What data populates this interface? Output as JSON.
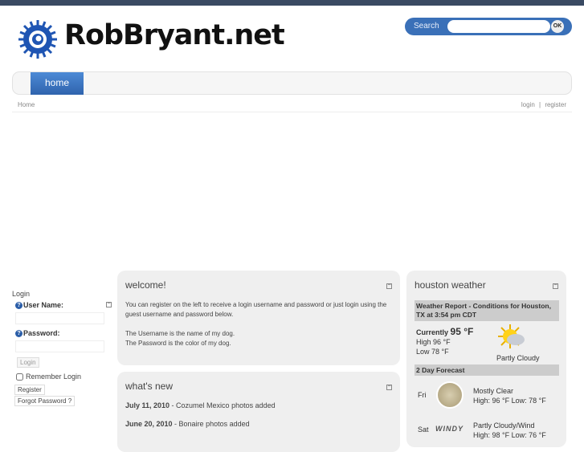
{
  "site": {
    "title": "RobBryant.net"
  },
  "search": {
    "label": "Search",
    "button": "OK",
    "value": ""
  },
  "nav": {
    "items": [
      "home"
    ]
  },
  "breadcrumb": "Home",
  "user_links": {
    "login": "login",
    "separator": "|",
    "register": "register"
  },
  "login": {
    "title": "Login",
    "username_label": "User Name:",
    "password_label": "Password:",
    "login_button": "Login",
    "remember": "Remember Login",
    "register_button": "Register",
    "forgot_button": "Forgot Password ?"
  },
  "welcome": {
    "title": "welcome!",
    "lines": [
      "You can register on the left to receive a login username and password or just login using the guest username and password below.",
      "The Username is the name of my dog.",
      "The Password is the color of my dog."
    ]
  },
  "whats_new": {
    "title": "what's new",
    "items": [
      {
        "date": "July 11, 2010",
        "text": " - Cozumel Mexico photos added"
      },
      {
        "date": "June 20, 2010",
        "text": " - Bonaire photos added"
      }
    ]
  },
  "weather": {
    "title": "houston weather",
    "report": "Weather Report - Conditions for Houston, TX at 3:54 pm CDT",
    "currently_label": "Currently",
    "current_temp": "95 °F",
    "high": "High 96 °F",
    "low": "Low 78 °F",
    "condition": "Partly Cloudy",
    "forecast_title": "2 Day Forecast",
    "forecast": [
      {
        "day": "Fri",
        "condition": "Mostly Clear",
        "temps": "High: 96 °F Low: 78 °F"
      },
      {
        "day": "Sat",
        "icon_text": "WINDY",
        "condition": "Partly Cloudy/Wind",
        "temps": "High: 98 °F Low: 76 °F"
      }
    ]
  }
}
